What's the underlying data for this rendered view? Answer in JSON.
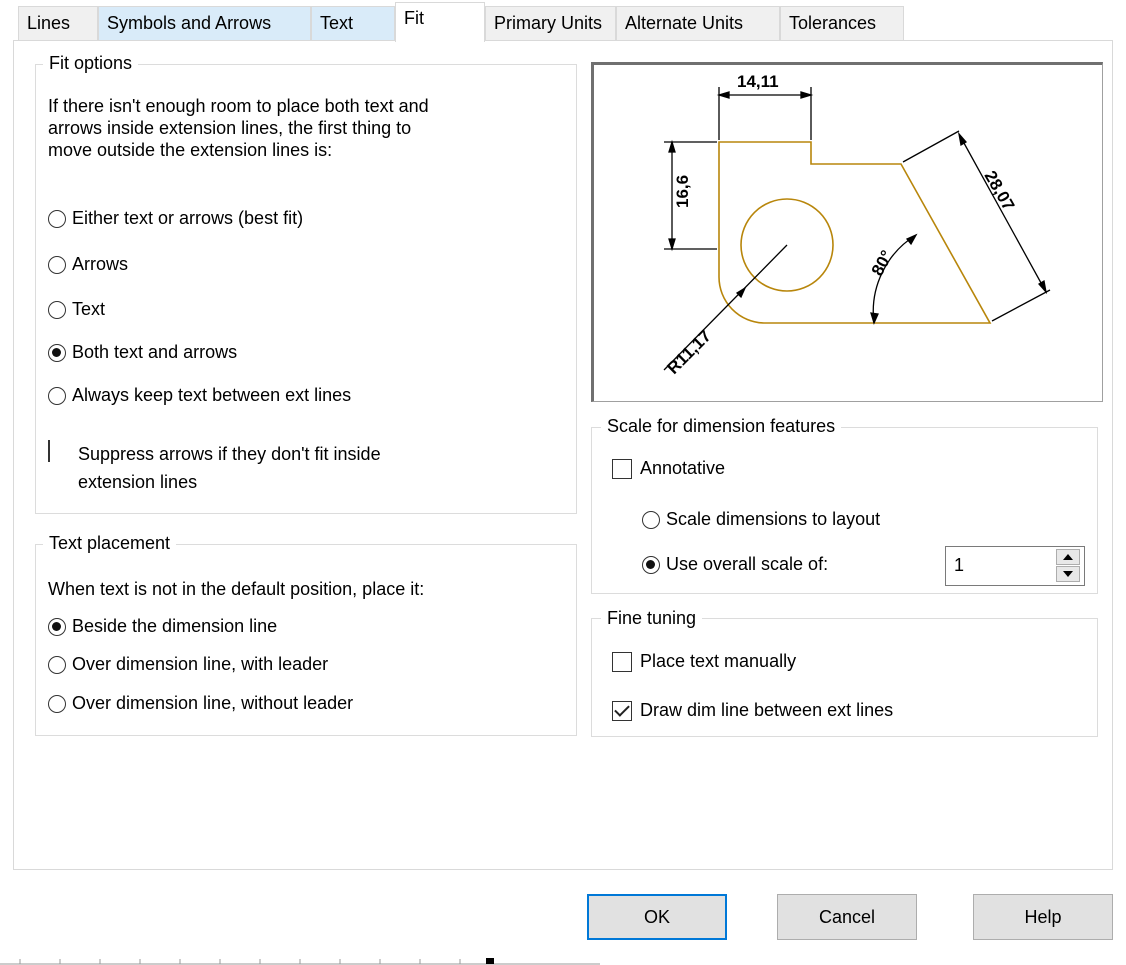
{
  "tabs": [
    {
      "label": "Lines",
      "state": "normal"
    },
    {
      "label": "Symbols and Arrows",
      "state": "highlight"
    },
    {
      "label": "Text",
      "state": "highlight"
    },
    {
      "label": "Fit",
      "state": "active"
    },
    {
      "label": "Primary Units",
      "state": "normal"
    },
    {
      "label": "Alternate Units",
      "state": "normal"
    },
    {
      "label": "Tolerances",
      "state": "normal"
    }
  ],
  "fit_options": {
    "title": "Fit options",
    "description": [
      "If there isn't enough room to place both text and",
      "arrows inside extension lines, the first thing to",
      "move outside the extension lines is:"
    ],
    "radios": [
      {
        "label": "Either text or arrows (best fit)",
        "checked": false
      },
      {
        "label": "Arrows",
        "checked": false
      },
      {
        "label": "Text",
        "checked": false
      },
      {
        "label": "Both text and arrows",
        "checked": true
      },
      {
        "label": "Always keep text between ext lines",
        "checked": false
      }
    ],
    "suppress": {
      "label_line1": "Suppress arrows if they don't fit inside",
      "label_line2": "extension lines",
      "checked": false
    }
  },
  "text_placement": {
    "title": "Text placement",
    "description": "When text is not in the default position, place it:",
    "radios": [
      {
        "label": "Beside the dimension line",
        "checked": true
      },
      {
        "label": "Over dimension line, with leader",
        "checked": false
      },
      {
        "label": "Over dimension line, without leader",
        "checked": false
      }
    ]
  },
  "preview": {
    "dims": {
      "top": "14,11",
      "left": "16,6",
      "right": "28,07",
      "angle": "80°",
      "radius": "R11,17"
    },
    "line_color": "#b8860b"
  },
  "scale": {
    "title": "Scale for dimension features",
    "annotative": {
      "label": "Annotative",
      "checked": false
    },
    "layout_radio": {
      "label": "Scale dimensions to layout",
      "checked": false
    },
    "overall_radio": {
      "label": "Use overall scale of:",
      "checked": true
    },
    "overall_value": "1"
  },
  "fine_tuning": {
    "title": "Fine tuning",
    "manual": {
      "label": "Place text manually",
      "checked": false
    },
    "dimline": {
      "label": "Draw dim line between ext lines",
      "checked": true
    }
  },
  "buttons": {
    "ok": "OK",
    "cancel": "Cancel",
    "help": "Help"
  },
  "colors": {
    "accent": "#0078d7",
    "tab_highlight": "#d9ebf9"
  }
}
